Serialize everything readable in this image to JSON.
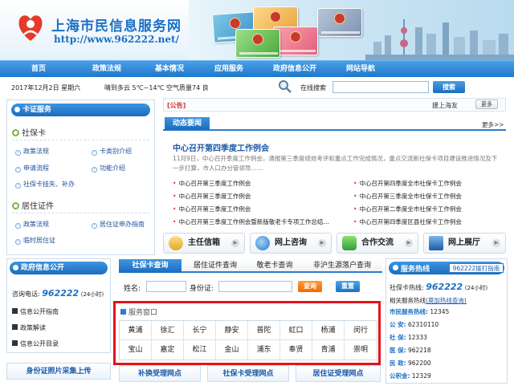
{
  "header": {
    "site_title": "上海市民信息服务网",
    "site_url": "http://www.962222.net/"
  },
  "nav": {
    "items": [
      "首页",
      "政策法规",
      "基本情况",
      "应用服务",
      "政府信息公开",
      "网站导航"
    ]
  },
  "infobar": {
    "date": "2017年12月2日  星期六",
    "weather": "晴到多云   5℃~14℃  空气质量74  良",
    "search_label": "在线搜索",
    "search_value": "",
    "search_button": "搜索"
  },
  "card_service": {
    "title": "卡证服务",
    "sscard_title": "社保卡",
    "sscard_links": [
      "政策法规",
      "卡类别介绍",
      "申请流程",
      "功能介绍",
      "社保卡挂失、补办"
    ],
    "residence_title": "居住证件",
    "residence_links": [
      "政策法规",
      "居住证申办指南",
      "临时居住证"
    ]
  },
  "announcement": {
    "tag": "[公告]",
    "text": "援上海友",
    "more": "更多"
  },
  "news": {
    "tab": "动态要闻",
    "more": "更多>>",
    "headline": "中心召开第四季度工作例会",
    "summary": "11月9日，中心召开季度工作例会，通报第三季度绩效考评和重点工作完成情况，重点交流新社保卡项目建设推进情况及下一步打算，市人口办分管领导……",
    "items_left": [
      "中心召开第三季度工作例会",
      "中心召开第三季度工作例会",
      "中心召开第三季度工作例会",
      "中心召开第三季度工作例会暨新版敬老卡专项工作总结…"
    ],
    "items_right": [
      "中心召开第四季度全市社保卡工作例会",
      "中心召开第三季度全市社保卡工作例会",
      "中心召开第二季度全市社保卡工作例会",
      "中心召开第四季度区县社保卡工作例会"
    ]
  },
  "services": [
    {
      "label": "主任信箱",
      "icon": "mailbox-icon"
    },
    {
      "label": "网上咨询",
      "icon": "globe-icon"
    },
    {
      "label": "合作交流",
      "icon": "puzzle-icon"
    },
    {
      "label": "网上展厅",
      "icon": "house-icon"
    }
  ],
  "gov_info": {
    "title": "政府信息公开",
    "phone_label": "咨询电话:",
    "phone": "962222",
    "phone_note": "(24小时)",
    "links": [
      "信息公开指南",
      "政策解读",
      "信息公开目录"
    ]
  },
  "query": {
    "tabs": [
      "社保卡查询",
      "居住证件查询",
      "敬老卡查询",
      "非沪生源落户查询"
    ],
    "name_label": "姓名:",
    "id_label": "身份证:",
    "query_button": "查询",
    "reset_button": "重置",
    "window_title": "服务窗口",
    "districts_row1": [
      "黄浦",
      "徐汇",
      "长宁",
      "静安",
      "普陀",
      "虹口",
      "杨浦",
      "闵行"
    ],
    "districts_row2": [
      "宝山",
      "嘉定",
      "松江",
      "金山",
      "浦东",
      "奉贤",
      "青浦",
      "崇明"
    ]
  },
  "bottom_links": [
    "身份证照片采集上传",
    "补换受理网点",
    "社保卡受理网点",
    "居住证受理网点"
  ],
  "hotline": {
    "title": "服务热线",
    "tag": "962222拨打指南",
    "sscard_label": "社保卡热线:",
    "sscard_number": "962222",
    "sscard_note": "(24小时)",
    "related_label": "相关服务热线",
    "related_link": "(莫加热线查询)",
    "rows": [
      {
        "k": "市民服务热线:",
        "v": "12345"
      },
      {
        "k": "公  安:",
        "v": "62310110"
      },
      {
        "k": "社  保:",
        "v": "12333"
      },
      {
        "k": "医  保:",
        "v": "962218"
      },
      {
        "k": "民  政:",
        "v": "962200"
      },
      {
        "k": "公积金:",
        "v": "12329"
      }
    ]
  },
  "colors": {
    "brand_blue": "#1d6fc3",
    "nav_blue": "#1f78cc",
    "highlight_red": "#e0141c",
    "orange": "#f06a00"
  }
}
